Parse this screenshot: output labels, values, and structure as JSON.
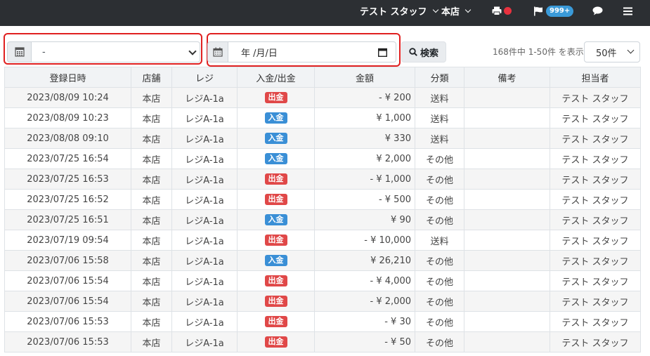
{
  "navbar": {
    "staff_label": "テスト スタッフ",
    "store_label": "本店",
    "notification_badge": "999+",
    "icons": [
      "printer-icon",
      "flag-icon",
      "chat-icon",
      "menu-icon"
    ],
    "status_dot_color": "#e8323f"
  },
  "filters": {
    "register_select_value": "-",
    "date_placeholder": "年 /月/日",
    "search_label": "検索",
    "count_text": "168件中 1-50件 を表示",
    "per_page_value": "50件"
  },
  "table": {
    "headers": [
      "登録日時",
      "店舗",
      "レジ",
      "入金/出金",
      "金額",
      "分類",
      "備考",
      "担当者"
    ],
    "rows": [
      {
        "date": "2023/08/09 10:24",
        "store": "本店",
        "register": "レジA-1a",
        "type": "出金",
        "kind": "out",
        "amount": "- ¥ 200",
        "category": "送料",
        "note": "",
        "staff": "テスト スタッフ"
      },
      {
        "date": "2023/08/09 10:23",
        "store": "本店",
        "register": "レジA-1a",
        "type": "入金",
        "kind": "in",
        "amount": "¥ 1,000",
        "category": "送料",
        "note": "",
        "staff": "テスト スタッフ"
      },
      {
        "date": "2023/08/08 09:10",
        "store": "本店",
        "register": "レジA-1a",
        "type": "入金",
        "kind": "in",
        "amount": "¥ 330",
        "category": "送料",
        "note": "",
        "staff": "テスト スタッフ"
      },
      {
        "date": "2023/07/25 16:54",
        "store": "本店",
        "register": "レジA-1a",
        "type": "入金",
        "kind": "in",
        "amount": "¥ 2,000",
        "category": "その他",
        "note": "",
        "staff": "テスト スタッフ"
      },
      {
        "date": "2023/07/25 16:53",
        "store": "本店",
        "register": "レジA-1a",
        "type": "出金",
        "kind": "out",
        "amount": "- ¥ 1,000",
        "category": "その他",
        "note": "",
        "staff": "テスト スタッフ"
      },
      {
        "date": "2023/07/25 16:52",
        "store": "本店",
        "register": "レジA-1a",
        "type": "出金",
        "kind": "out",
        "amount": "- ¥ 500",
        "category": "その他",
        "note": "",
        "staff": "テスト スタッフ"
      },
      {
        "date": "2023/07/25 16:51",
        "store": "本店",
        "register": "レジA-1a",
        "type": "入金",
        "kind": "in",
        "amount": "¥ 90",
        "category": "その他",
        "note": "",
        "staff": "テスト スタッフ"
      },
      {
        "date": "2023/07/19 09:54",
        "store": "本店",
        "register": "レジA-1a",
        "type": "出金",
        "kind": "out",
        "amount": "- ¥ 10,000",
        "category": "送料",
        "note": "",
        "staff": "テスト スタッフ"
      },
      {
        "date": "2023/07/06 15:58",
        "store": "本店",
        "register": "レジA-1a",
        "type": "入金",
        "kind": "in",
        "amount": "¥ 26,210",
        "category": "その他",
        "note": "",
        "staff": "テスト スタッフ"
      },
      {
        "date": "2023/07/06 15:54",
        "store": "本店",
        "register": "レジA-1a",
        "type": "出金",
        "kind": "out",
        "amount": "- ¥ 4,000",
        "category": "その他",
        "note": "",
        "staff": "テスト スタッフ"
      },
      {
        "date": "2023/07/06 15:54",
        "store": "本店",
        "register": "レジA-1a",
        "type": "出金",
        "kind": "out",
        "amount": "- ¥ 2,000",
        "category": "その他",
        "note": "",
        "staff": "テスト スタッフ"
      },
      {
        "date": "2023/07/06 15:53",
        "store": "本店",
        "register": "レジA-1a",
        "type": "出金",
        "kind": "out",
        "amount": "- ¥ 30",
        "category": "その他",
        "note": "",
        "staff": "テスト スタッフ"
      },
      {
        "date": "2023/07/06 15:53",
        "store": "本店",
        "register": "レジA-1a",
        "type": "出金",
        "kind": "out",
        "amount": "- ¥ 50",
        "category": "その他",
        "note": "",
        "staff": "テスト スタッフ"
      }
    ]
  },
  "colors": {
    "navbar_bg": "#2c2f33",
    "tag_out": "#e04848",
    "tag_in": "#3a8fd6",
    "amount_out": "#e03a3a",
    "highlight": "#e02020"
  }
}
